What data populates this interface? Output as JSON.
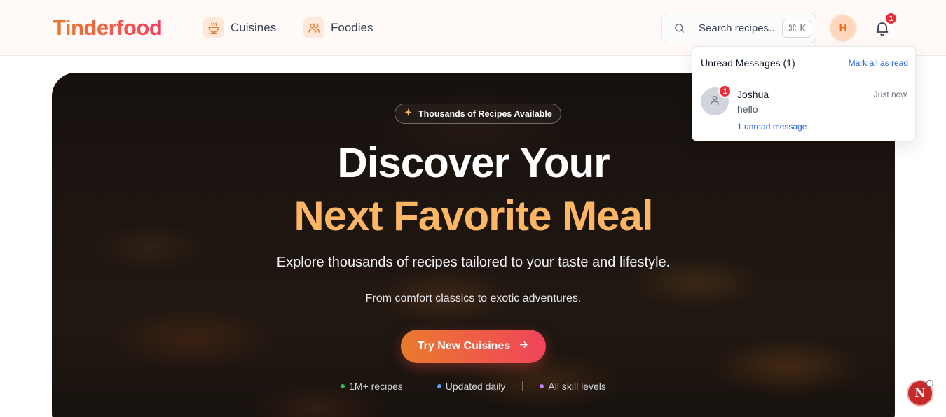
{
  "header": {
    "logo": "Tinderfood",
    "nav": [
      {
        "label": "Cuisines",
        "icon": "bowl-icon"
      },
      {
        "label": "Foodies",
        "icon": "users-icon"
      }
    ],
    "search": {
      "placeholder": "Search recipes...",
      "shortcut": "⌘ K"
    },
    "avatar_initial": "H",
    "notification_count": "1"
  },
  "hero": {
    "pill": "Thousands of Recipes Available",
    "title_line1": "Discover Your",
    "title_line2": "Next Favorite Meal",
    "subtitle": "Explore thousands of recipes tailored to your taste and lifestyle.",
    "subtitle2": "From comfort classics to exotic adventures.",
    "cta": "Try New Cuisines",
    "stats": [
      {
        "label": "1M+ recipes",
        "color": "#22c55e"
      },
      {
        "label": "Updated daily",
        "color": "#60a5fa"
      },
      {
        "label": "All skill levels",
        "color": "#c084fc"
      }
    ]
  },
  "notifications": {
    "title": "Unread Messages (1)",
    "mark_all": "Mark all as read",
    "messages": [
      {
        "name": "Joshua",
        "time": "Just now",
        "body": "hello",
        "unread": "1 unread message",
        "badge": "1"
      }
    ]
  },
  "fab": {
    "label": "N"
  },
  "colors": {
    "accent": "#ea7a2e",
    "accent2": "#f43f5e",
    "highlight": "#fdb663",
    "link": "#2563eb",
    "badge": "#ef2b3b"
  }
}
